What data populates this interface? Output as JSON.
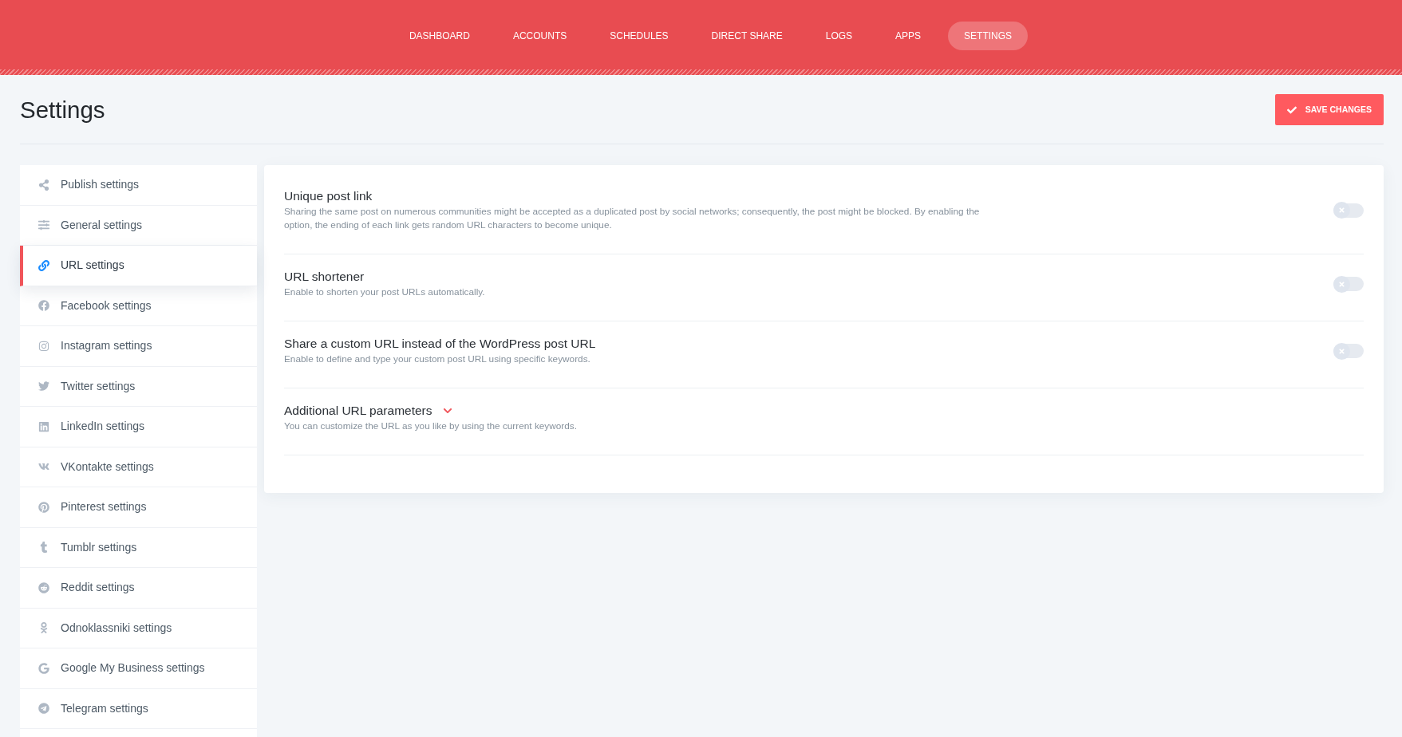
{
  "nav": {
    "items": [
      {
        "label": "DASHBOARD",
        "selected": false
      },
      {
        "label": "ACCOUNTS",
        "selected": false
      },
      {
        "label": "SCHEDULES",
        "selected": false
      },
      {
        "label": "DIRECT SHARE",
        "selected": false
      },
      {
        "label": "LOGS",
        "selected": false
      },
      {
        "label": "APPS",
        "selected": false
      },
      {
        "label": "SETTINGS",
        "selected": true
      }
    ]
  },
  "page": {
    "title": "Settings",
    "save_button": "SAVE CHANGES"
  },
  "sidebar": {
    "items": [
      {
        "label": "Publish settings",
        "selected": false
      },
      {
        "label": "General settings",
        "selected": false
      },
      {
        "label": "URL settings",
        "selected": true
      },
      {
        "label": "Facebook settings",
        "selected": false
      },
      {
        "label": "Instagram settings",
        "selected": false
      },
      {
        "label": "Twitter settings",
        "selected": false
      },
      {
        "label": "LinkedIn settings",
        "selected": false
      },
      {
        "label": "VKontakte settings",
        "selected": false
      },
      {
        "label": "Pinterest settings",
        "selected": false
      },
      {
        "label": "Tumblr settings",
        "selected": false
      },
      {
        "label": "Reddit settings",
        "selected": false
      },
      {
        "label": "Odnoklassniki settings",
        "selected": false
      },
      {
        "label": "Google My Business settings",
        "selected": false
      },
      {
        "label": "Telegram settings",
        "selected": false
      }
    ]
  },
  "settings": [
    {
      "kind": "toggle",
      "title": "Unique post link",
      "description": "Sharing the same post on numerous communities might be accepted as a duplicated post by social networks; consequently, the post might be blocked. By enabling the option, the ending of each link gets random URL characters to become unique.",
      "on": false
    },
    {
      "kind": "toggle",
      "title": "URL shortener",
      "description": "Enable to shorten your post URLs automatically.",
      "on": false
    },
    {
      "kind": "toggle",
      "title": "Share a custom URL instead of the WordPress post URL",
      "description": "Enable to define and type your custom post URL using specific keywords.",
      "on": false
    },
    {
      "kind": "expander",
      "title": "Additional URL parameters",
      "description": "You can customize the URL as you like by using the current keywords.",
      "expanded": false
    }
  ]
}
